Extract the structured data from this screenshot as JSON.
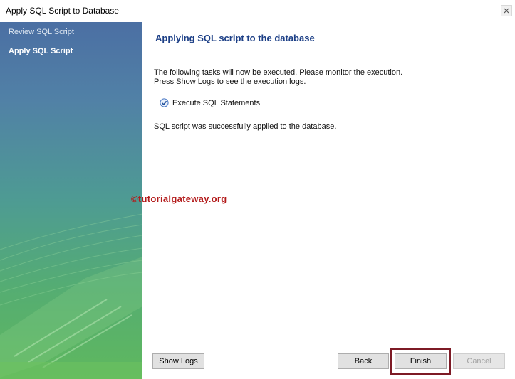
{
  "window": {
    "title": "Apply SQL Script to Database",
    "close_icon": "close-icon"
  },
  "sidebar": {
    "items": [
      {
        "label": "Review SQL Script",
        "active": false
      },
      {
        "label": "Apply SQL Script",
        "active": true
      }
    ],
    "gradient_colors": [
      "#4b6fa3",
      "#4e9b93",
      "#5fb85e"
    ]
  },
  "main": {
    "heading": "Applying SQL script to the database",
    "description_line1": "The following tasks will now be executed. Please monitor the execution.",
    "description_line2": "Press Show Logs to see the execution logs.",
    "tasks": [
      {
        "label": "Execute SQL Statements",
        "status": "checked",
        "icon": "check-circle-icon"
      }
    ],
    "result": "SQL script was successfully applied to the database.",
    "watermark": "©tutorialgateway.org",
    "heading_color": "#1c3f86",
    "watermark_color": "#b31b1b",
    "highlight_color": "#7d1a25"
  },
  "buttons": {
    "show_logs": "Show Logs",
    "back": "Back",
    "finish": "Finish",
    "cancel": "Cancel"
  }
}
